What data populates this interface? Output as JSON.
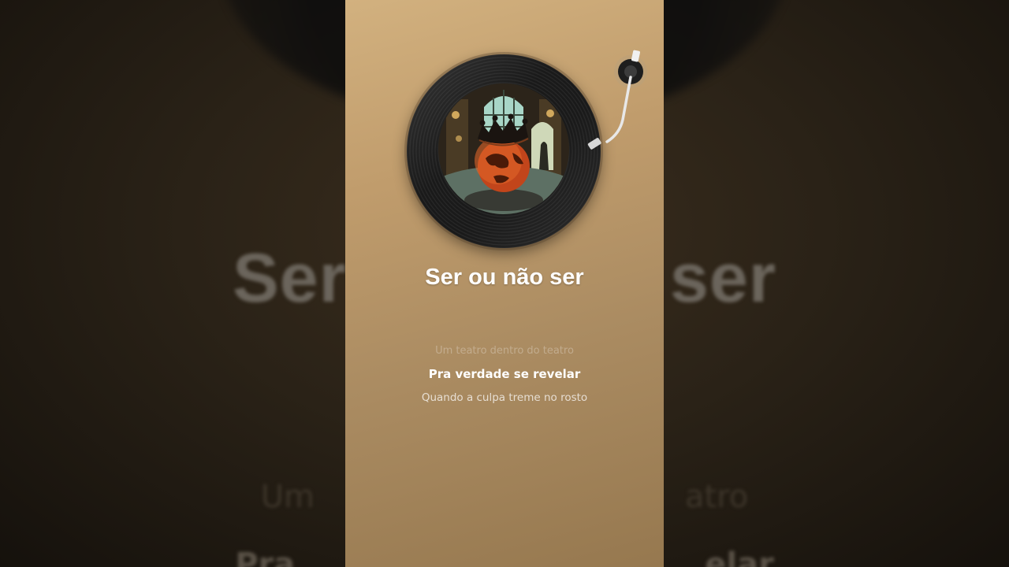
{
  "song": {
    "title": "Ser ou não ser"
  },
  "lyrics": {
    "previous": "Um teatro dentro do teatro",
    "current": "Pra verdade se revelar",
    "next": "Quando a culpa treme no rosto"
  },
  "background": {
    "title_fragment_left": "Ser",
    "title_fragment_right": "ser",
    "line1_left": "Um",
    "line1_right": "atro",
    "line2_left": "Pra",
    "line2_right": "elar"
  },
  "icons": {
    "record": "vinyl-record-icon",
    "tonearm": "tonearm-icon",
    "cover": "album-cover-art"
  },
  "colors": {
    "panel_top": "#d2b17f",
    "panel_bottom": "#96784f",
    "globe": "#c2451b",
    "title": "#ffffff"
  }
}
